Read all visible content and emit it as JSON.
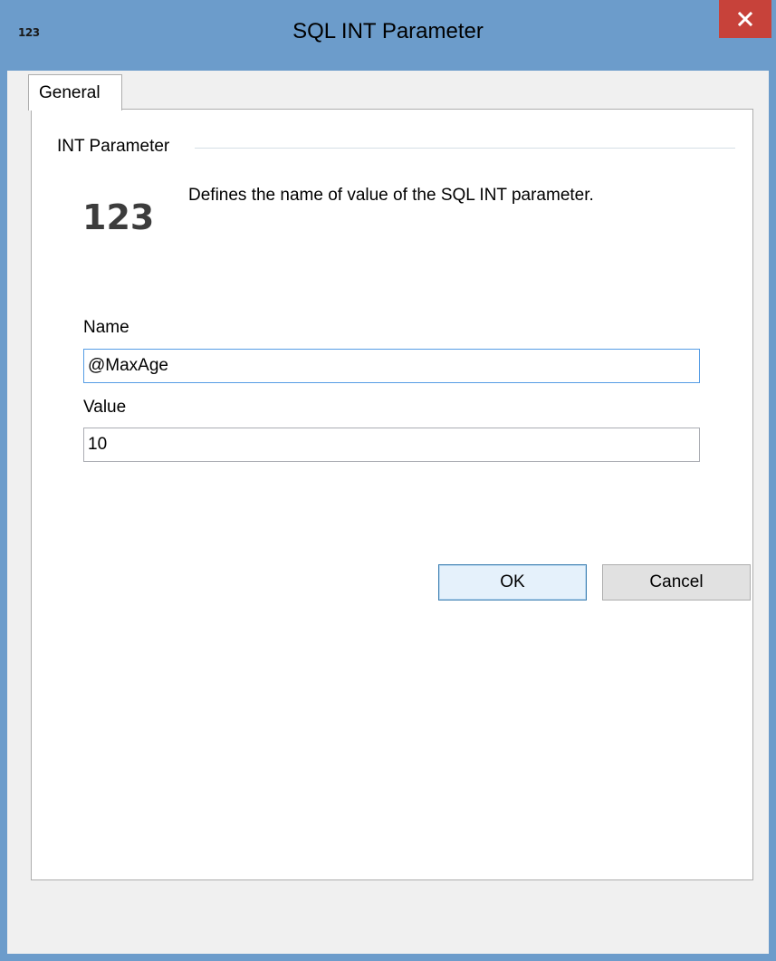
{
  "window": {
    "title": "SQL INT Parameter",
    "app_icon_text": "123",
    "close_symbol": "✕"
  },
  "tabs": [
    {
      "label": "General",
      "selected": true
    }
  ],
  "group": {
    "label": "INT Parameter",
    "icon_text": "123",
    "description": "Defines the name of value of the SQL INT parameter."
  },
  "fields": {
    "name": {
      "label": "Name",
      "value": "@MaxAge"
    },
    "value": {
      "label": "Value",
      "value": "10"
    }
  },
  "buttons": {
    "ok_label": "OK",
    "cancel_label": "Cancel"
  },
  "colors": {
    "title_bar": "#6c9ccb",
    "close_button": "#c7423a",
    "focus_border": "#569de5"
  }
}
